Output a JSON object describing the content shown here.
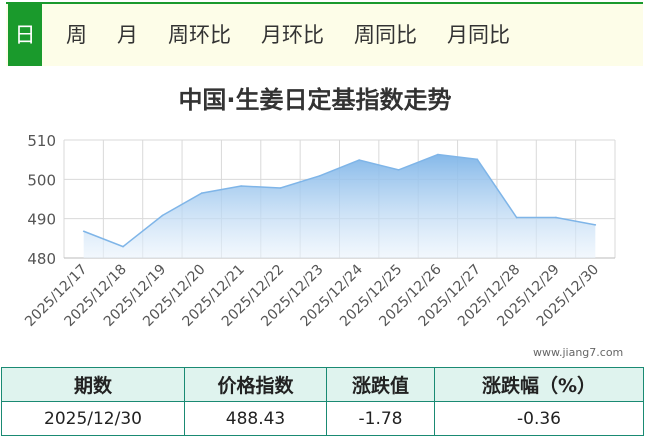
{
  "tabs": [
    {
      "label": "日",
      "active": true
    },
    {
      "label": "周"
    },
    {
      "label": "月"
    },
    {
      "label": "周环比"
    },
    {
      "label": "月环比"
    },
    {
      "label": "周同比"
    },
    {
      "label": "月同比"
    }
  ],
  "watermark": "www.jiang7.com",
  "summary": {
    "headers": [
      "期数",
      "价格指数",
      "涨跌值",
      "涨跌幅（%）"
    ],
    "row": [
      "2025/12/30",
      "488.43",
      "-1.78",
      "-0.36"
    ]
  },
  "colors": {
    "accent": "#1a9a2c",
    "line": "#7fb5e8",
    "table_border": "#1a8a73"
  },
  "chart_data": {
    "type": "area",
    "title": "中国·生姜日定基指数走势",
    "x": [
      "2025/12/17",
      "2025/12/18",
      "2025/12/19",
      "2025/12/20",
      "2025/12/21",
      "2025/12/22",
      "2025/12/23",
      "2025/12/24",
      "2025/12/25",
      "2025/12/26",
      "2025/12/27",
      "2025/12/28",
      "2025/12/29",
      "2025/12/30"
    ],
    "series": [
      {
        "values": [
          486.8,
          482.9,
          490.8,
          496.5,
          498.3,
          497.8,
          500.9,
          504.9,
          502.4,
          506.3,
          505.1,
          490.3,
          490.3,
          488.43
        ]
      }
    ],
    "yticks": [
      480,
      490,
      500,
      510
    ],
    "ylim": [
      480,
      510
    ],
    "grid": true,
    "legend": "none"
  }
}
